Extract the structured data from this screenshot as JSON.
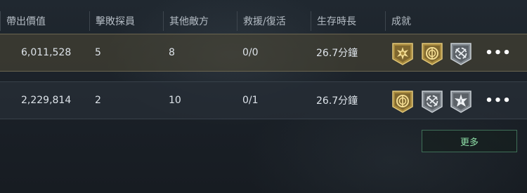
{
  "table": {
    "columns": [
      "帶出價值",
      "擊敗探員",
      "其他敵方",
      "救援/復活",
      "生存時長",
      "成就"
    ],
    "rows": [
      {
        "value": "6,011,528",
        "agents_defeated": "5",
        "other_enemies": "8",
        "rescue_revive": "0/0",
        "survival_time": "26.7分鐘",
        "achievements": [
          {
            "icon": "gold-star-burst-icon",
            "tier": "gold"
          },
          {
            "icon": "gold-compass-icon",
            "tier": "gold"
          },
          {
            "icon": "silver-crossed-arrows-icon",
            "tier": "silver"
          }
        ],
        "more": "•••"
      },
      {
        "value": "2,229,814",
        "agents_defeated": "2",
        "other_enemies": "10",
        "rescue_revive": "0/1",
        "survival_time": "26.7分鐘",
        "achievements": [
          {
            "icon": "gold-compass-icon",
            "tier": "gold"
          },
          {
            "icon": "silver-crossed-arrows-icon",
            "tier": "silver"
          },
          {
            "icon": "silver-star-burst-icon",
            "tier": "silver"
          }
        ],
        "more": "•••"
      }
    ]
  },
  "more_button": {
    "label": "更多"
  },
  "colors": {
    "background": "#1b2128",
    "highlight_row": "#4e4834",
    "gold_badge": "#b8953e",
    "silver_badge": "#8a9199",
    "accent_green": "#8fe0a8"
  }
}
